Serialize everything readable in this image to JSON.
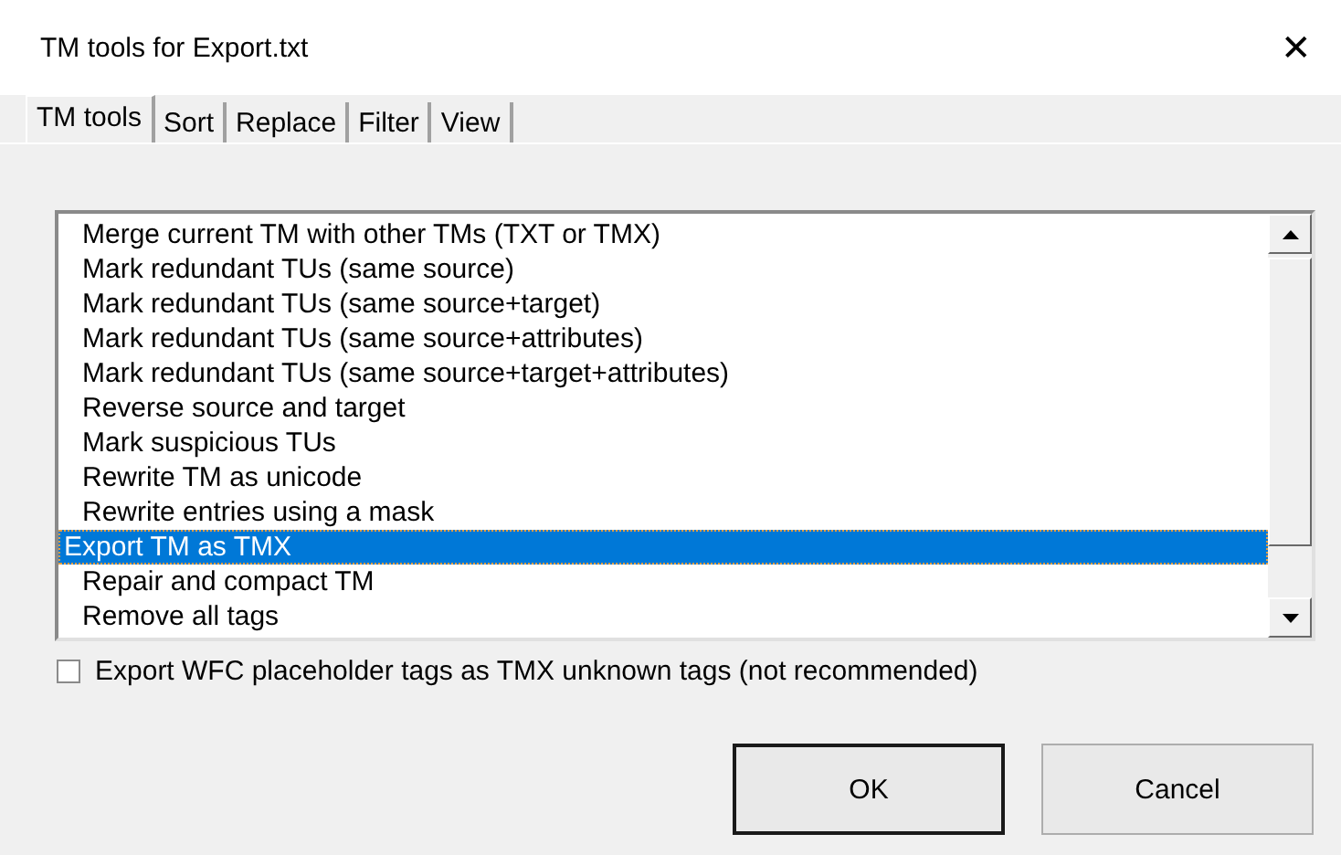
{
  "window": {
    "title": "TM tools for Export.txt",
    "close": "✕"
  },
  "tabs": [
    {
      "label": "TM tools",
      "selected": true
    },
    {
      "label": "Sort",
      "selected": false
    },
    {
      "label": "Replace",
      "selected": false
    },
    {
      "label": "Filter",
      "selected": false
    },
    {
      "label": "View",
      "selected": false
    }
  ],
  "list": {
    "items": [
      {
        "label": "Merge current TM with other TMs (TXT or TMX)",
        "selected": false
      },
      {
        "label": "Mark redundant TUs (same source)",
        "selected": false
      },
      {
        "label": "Mark redundant TUs (same source+target)",
        "selected": false
      },
      {
        "label": "Mark redundant TUs (same source+attributes)",
        "selected": false
      },
      {
        "label": "Mark redundant TUs (same source+target+attributes)",
        "selected": false
      },
      {
        "label": "Reverse source and target",
        "selected": false
      },
      {
        "label": "Mark suspicious TUs",
        "selected": false
      },
      {
        "label": "Rewrite TM as unicode",
        "selected": false
      },
      {
        "label": "Rewrite entries using a mask",
        "selected": false
      },
      {
        "label": "Export TM as TMX",
        "selected": true
      },
      {
        "label": "Repair and compact TM",
        "selected": false
      },
      {
        "label": "Remove all tags",
        "selected": false
      }
    ]
  },
  "checkbox": {
    "label": "Export WFC placeholder tags as TMX unknown tags (not recommended)",
    "checked": false
  },
  "buttons": [
    {
      "label": "OK",
      "kind": "default"
    },
    {
      "label": "Cancel",
      "kind": "normal"
    }
  ]
}
